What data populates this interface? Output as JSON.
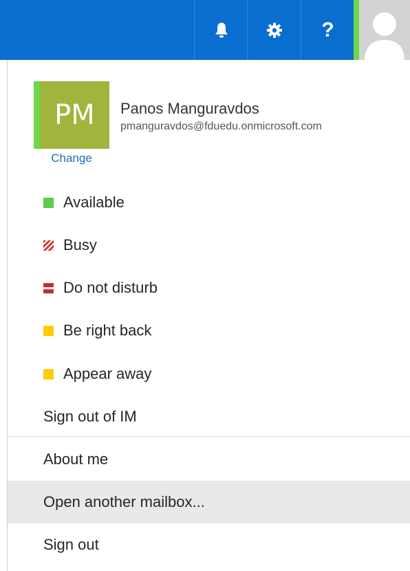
{
  "header": {
    "notifications_icon": "bell-icon",
    "settings_icon": "gear-icon",
    "help_label": "?",
    "avatar_icon": "user-silhouette-icon",
    "presence_color": "#6ed84a"
  },
  "profile": {
    "initials": "PM",
    "name": "Panos Manguravdos",
    "email": "pmanguravdos@fduedu.onmicrosoft.com",
    "change_label": "Change"
  },
  "status": [
    {
      "label": "Available",
      "icon": "available-square-icon",
      "color": "#5ccc4b"
    },
    {
      "label": "Busy",
      "icon": "busy-striped-icon",
      "color": "#d23333"
    },
    {
      "label": "Do not disturb",
      "icon": "do-not-disturb-icon",
      "color": "#c62f2f"
    },
    {
      "label": "Be right back",
      "icon": "be-right-back-icon",
      "color": "#ffcc00"
    },
    {
      "label": "Appear away",
      "icon": "appear-away-icon",
      "color": "#ffcc00"
    }
  ],
  "menu": {
    "sign_out_im": "Sign out of IM",
    "about_me": "About me",
    "open_mailbox": "Open another mailbox...",
    "sign_out": "Sign out"
  },
  "theme": {
    "topbar": "#0a6ed1",
    "profile_bg": "#9fb53c",
    "link": "#1f6fb5",
    "hover": "#e9e9e9"
  }
}
